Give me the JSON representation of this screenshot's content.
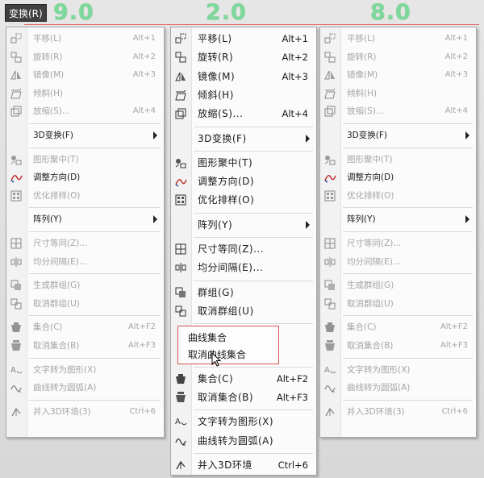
{
  "menubar": {
    "button_label": "变换(R)"
  },
  "versions": [
    "9.0",
    "2.0",
    "8.0"
  ],
  "menus": [
    {
      "id": "v9",
      "items": [
        {
          "type": "item",
          "icon": "move-icon",
          "label": "平移(L)",
          "shortcut": "Alt+1",
          "state": "disabled"
        },
        {
          "type": "item",
          "icon": "rotate-icon",
          "label": "旋转(R)",
          "shortcut": "Alt+2",
          "state": "disabled"
        },
        {
          "type": "item",
          "icon": "mirror-icon",
          "label": "镜像(M)",
          "shortcut": "Alt+3",
          "state": "disabled"
        },
        {
          "type": "item",
          "icon": "skew-icon",
          "label": "倾斜(H)",
          "shortcut": "",
          "state": "disabled"
        },
        {
          "type": "item",
          "icon": "scale-icon",
          "label": "放缩(S)...",
          "shortcut": "Alt+4",
          "state": "disabled"
        },
        {
          "type": "sep"
        },
        {
          "type": "item",
          "icon": "",
          "label": "3D变换(F)",
          "shortcut": "",
          "state": "enabled",
          "submenu": true
        },
        {
          "type": "sep"
        },
        {
          "type": "item",
          "icon": "center-shape-icon",
          "label": "图形聚中(T)",
          "shortcut": "",
          "state": "disabled"
        },
        {
          "type": "item",
          "icon": "adjust-direction-icon",
          "label": "调整方向(D)",
          "shortcut": "",
          "state": "enabled"
        },
        {
          "type": "item",
          "icon": "optimize-sort-icon",
          "label": "优化排样(O)",
          "shortcut": "",
          "state": "disabled"
        },
        {
          "type": "sep"
        },
        {
          "type": "item",
          "icon": "",
          "label": "阵列(Y)",
          "shortcut": "",
          "state": "enabled",
          "submenu": true
        },
        {
          "type": "sep"
        },
        {
          "type": "item",
          "icon": "equal-size-icon",
          "label": "尺寸等同(Z)...",
          "shortcut": "",
          "state": "disabled"
        },
        {
          "type": "item",
          "icon": "equal-spacing-icon",
          "label": "均分间隔(E)...",
          "shortcut": "",
          "state": "disabled"
        },
        {
          "type": "sep"
        },
        {
          "type": "item",
          "icon": "group-icon",
          "label": "生成群组(G)",
          "shortcut": "",
          "state": "disabled"
        },
        {
          "type": "item",
          "icon": "ungroup-icon",
          "label": "取消群组(U)",
          "shortcut": "",
          "state": "disabled"
        },
        {
          "type": "sep"
        },
        {
          "type": "item",
          "icon": "combine-icon",
          "label": "集合(C)",
          "shortcut": "Alt+F2",
          "state": "disabled"
        },
        {
          "type": "item",
          "icon": "uncombine-icon",
          "label": "取消集合(B)",
          "shortcut": "Alt+F3",
          "state": "disabled"
        },
        {
          "type": "sep"
        },
        {
          "type": "item",
          "icon": "text-to-shape-icon",
          "label": "文字转为图形(X)",
          "shortcut": "",
          "state": "disabled"
        },
        {
          "type": "item",
          "icon": "curve-to-arc-icon",
          "label": "曲线转为圆弧(A)",
          "shortcut": "",
          "state": "disabled"
        },
        {
          "type": "sep"
        },
        {
          "type": "item",
          "icon": "3d-env-icon",
          "label": "并入3D环境(3)",
          "shortcut": "Ctrl+6",
          "state": "disabled"
        }
      ]
    },
    {
      "id": "v2",
      "items": [
        {
          "type": "item",
          "icon": "move-icon",
          "label": "平移(L)",
          "shortcut": "Alt+1",
          "state": "enabled"
        },
        {
          "type": "item",
          "icon": "rotate-icon",
          "label": "旋转(R)",
          "shortcut": "Alt+2",
          "state": "enabled"
        },
        {
          "type": "item",
          "icon": "mirror-icon",
          "label": "镜像(M)",
          "shortcut": "Alt+3",
          "state": "enabled"
        },
        {
          "type": "item",
          "icon": "skew-icon",
          "label": "倾斜(H)",
          "shortcut": "",
          "state": "enabled"
        },
        {
          "type": "item",
          "icon": "scale-icon",
          "label": "放缩(S)...",
          "shortcut": "Alt+4",
          "state": "enabled"
        },
        {
          "type": "sep"
        },
        {
          "type": "item",
          "icon": "",
          "label": "3D变换(F)",
          "shortcut": "",
          "state": "enabled",
          "submenu": true
        },
        {
          "type": "sep"
        },
        {
          "type": "item",
          "icon": "center-shape-icon",
          "label": "图形聚中(T)",
          "shortcut": "",
          "state": "enabled"
        },
        {
          "type": "item",
          "icon": "adjust-direction-icon",
          "label": "调整方向(D)",
          "shortcut": "",
          "state": "enabled"
        },
        {
          "type": "item",
          "icon": "optimize-sort-icon",
          "label": "优化排样(O)",
          "shortcut": "",
          "state": "enabled"
        },
        {
          "type": "sep"
        },
        {
          "type": "item",
          "icon": "",
          "label": "阵列(Y)",
          "shortcut": "",
          "state": "enabled",
          "submenu": true
        },
        {
          "type": "sep"
        },
        {
          "type": "item",
          "icon": "equal-size-icon",
          "label": "尺寸等同(Z)...",
          "shortcut": "",
          "state": "enabled"
        },
        {
          "type": "item",
          "icon": "equal-spacing-icon",
          "label": "均分间隔(E)...",
          "shortcut": "",
          "state": "enabled"
        },
        {
          "type": "sep"
        },
        {
          "type": "item",
          "icon": "group-icon",
          "label": "群组(G)",
          "shortcut": "",
          "state": "enabled"
        },
        {
          "type": "item",
          "icon": "ungroup-icon",
          "label": "取消群组(U)",
          "shortcut": "",
          "state": "enabled"
        },
        {
          "type": "sep"
        },
        {
          "type": "item",
          "icon": "",
          "label": "",
          "shortcut": "",
          "state": "blank"
        },
        {
          "type": "item",
          "icon": "",
          "label": "",
          "shortcut": "",
          "state": "blank"
        },
        {
          "type": "sep"
        },
        {
          "type": "item",
          "icon": "combine-icon",
          "label": "集合(C)",
          "shortcut": "Alt+F2",
          "state": "enabled"
        },
        {
          "type": "item",
          "icon": "uncombine-icon",
          "label": "取消集合(B)",
          "shortcut": "Alt+F3",
          "state": "enabled"
        },
        {
          "type": "sep"
        },
        {
          "type": "item",
          "icon": "text-to-shape-icon",
          "label": "文字转为图形(X)",
          "shortcut": "",
          "state": "enabled"
        },
        {
          "type": "item",
          "icon": "curve-to-arc-icon",
          "label": "曲线转为圆弧(A)",
          "shortcut": "",
          "state": "enabled"
        },
        {
          "type": "sep"
        },
        {
          "type": "item",
          "icon": "3d-env-icon",
          "label": "并入3D环境",
          "shortcut": "Ctrl+6",
          "state": "enabled"
        }
      ]
    },
    {
      "id": "v8",
      "items": [
        {
          "type": "item",
          "icon": "move-icon",
          "label": "平移(L)",
          "shortcut": "Alt+1",
          "state": "disabled"
        },
        {
          "type": "item",
          "icon": "rotate-icon",
          "label": "旋转(R)",
          "shortcut": "Alt+2",
          "state": "disabled"
        },
        {
          "type": "item",
          "icon": "mirror-icon",
          "label": "镜像(M)",
          "shortcut": "Alt+3",
          "state": "disabled"
        },
        {
          "type": "item",
          "icon": "skew-icon",
          "label": "倾斜(H)",
          "shortcut": "",
          "state": "disabled"
        },
        {
          "type": "item",
          "icon": "scale-icon",
          "label": "放缩(S)...",
          "shortcut": "Alt+4",
          "state": "disabled"
        },
        {
          "type": "sep"
        },
        {
          "type": "item",
          "icon": "",
          "label": "3D变换(F)",
          "shortcut": "",
          "state": "enabled",
          "submenu": true
        },
        {
          "type": "sep"
        },
        {
          "type": "item",
          "icon": "center-shape-icon",
          "label": "图形聚中(T)",
          "shortcut": "",
          "state": "disabled"
        },
        {
          "type": "item",
          "icon": "adjust-direction-icon",
          "label": "调整方向(D)",
          "shortcut": "",
          "state": "enabled"
        },
        {
          "type": "item",
          "icon": "optimize-sort-icon",
          "label": "优化排样(O)",
          "shortcut": "",
          "state": "disabled"
        },
        {
          "type": "sep"
        },
        {
          "type": "item",
          "icon": "",
          "label": "阵列(Y)",
          "shortcut": "",
          "state": "enabled",
          "submenu": true
        },
        {
          "type": "sep"
        },
        {
          "type": "item",
          "icon": "equal-size-icon",
          "label": "尺寸等同(Z)...",
          "shortcut": "",
          "state": "disabled"
        },
        {
          "type": "item",
          "icon": "equal-spacing-icon",
          "label": "均分间隔(E)...",
          "shortcut": "",
          "state": "disabled"
        },
        {
          "type": "sep"
        },
        {
          "type": "item",
          "icon": "group-icon",
          "label": "生成群组(G)",
          "shortcut": "",
          "state": "disabled"
        },
        {
          "type": "item",
          "icon": "ungroup-icon",
          "label": "取消群组(U)",
          "shortcut": "",
          "state": "disabled"
        },
        {
          "type": "sep"
        },
        {
          "type": "item",
          "icon": "combine-icon",
          "label": "集合(C)",
          "shortcut": "Alt+F2",
          "state": "disabled"
        },
        {
          "type": "item",
          "icon": "uncombine-icon",
          "label": "取消集合(B)",
          "shortcut": "Alt+F3",
          "state": "disabled"
        },
        {
          "type": "sep"
        },
        {
          "type": "item",
          "icon": "text-to-shape-icon",
          "label": "文字转为图形(X)",
          "shortcut": "",
          "state": "disabled"
        },
        {
          "type": "item",
          "icon": "curve-to-arc-icon",
          "label": "曲线转为圆弧(A)",
          "shortcut": "",
          "state": "disabled"
        },
        {
          "type": "sep"
        },
        {
          "type": "item",
          "icon": "3d-env-icon",
          "label": "并入3D环境(3)",
          "shortcut": "Ctrl+6",
          "state": "disabled"
        }
      ]
    }
  ],
  "popup": {
    "items": [
      "曲线集合",
      "取消曲线集合"
    ]
  },
  "colors": {
    "version_text": "#7dd99a",
    "highlight_box": "#d9534f",
    "disabled_text": "#a5a5a5"
  }
}
